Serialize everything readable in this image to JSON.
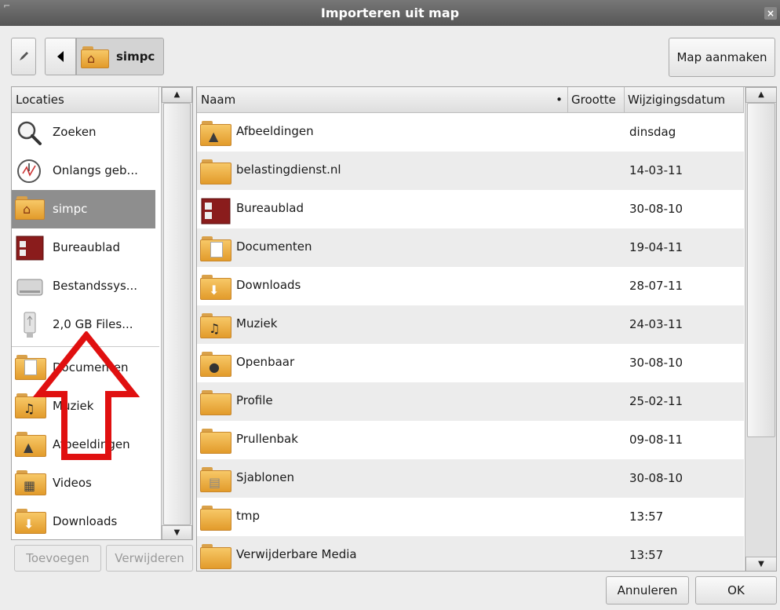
{
  "window": {
    "title": "Importeren uit map",
    "close_glyph": "×"
  },
  "toolbar": {
    "edit_icon": "pencil-icon",
    "back_icon": "triangle-left-icon",
    "path_label": "simpc",
    "create_folder_label": "Map aanmaken"
  },
  "places": {
    "header": "Locaties",
    "items": [
      {
        "label": "Zoeken",
        "icon": "search-icon"
      },
      {
        "label": "Onlangs geb...",
        "icon": "recent-clock-icon"
      },
      {
        "label": "simpc",
        "icon": "home-folder-icon",
        "selected": true
      },
      {
        "label": "Bureaublad",
        "icon": "desktop-icon"
      },
      {
        "label": "Bestandssys...",
        "icon": "harddisk-icon"
      },
      {
        "label": "2,0 GB Files...",
        "icon": "usb-drive-icon"
      },
      {
        "label": "Documenten",
        "icon": "documents-folder-icon"
      },
      {
        "label": "Muziek",
        "icon": "music-folder-icon"
      },
      {
        "label": "Afbeeldingen",
        "icon": "pictures-folder-icon"
      },
      {
        "label": "Videos",
        "icon": "videos-folder-icon"
      },
      {
        "label": "Downloads",
        "icon": "downloads-folder-icon"
      }
    ],
    "add_label": "Toevoegen",
    "remove_label": "Verwijderen"
  },
  "files": {
    "columns": {
      "name": "Naam",
      "size": "Grootte",
      "modified": "Wijzigingsdatum"
    },
    "sort_indicator": "•",
    "rows": [
      {
        "name": "Afbeeldingen",
        "date": "dinsdag",
        "icon": "pictures-folder-icon"
      },
      {
        "name": "belastingdienst.nl",
        "date": "14-03-11",
        "icon": "folder-icon"
      },
      {
        "name": "Bureaublad",
        "date": "30-08-10",
        "icon": "desktop-icon"
      },
      {
        "name": "Documenten",
        "date": "19-04-11",
        "icon": "documents-folder-icon"
      },
      {
        "name": "Downloads",
        "date": "28-07-11",
        "icon": "downloads-folder-icon"
      },
      {
        "name": "Muziek",
        "date": "24-03-11",
        "icon": "music-folder-icon"
      },
      {
        "name": "Openbaar",
        "date": "30-08-10",
        "icon": "public-folder-icon"
      },
      {
        "name": "Profile",
        "date": "25-02-11",
        "icon": "folder-icon"
      },
      {
        "name": "Prullenbak",
        "date": "09-08-11",
        "icon": "folder-icon"
      },
      {
        "name": "Sjablonen",
        "date": "30-08-10",
        "icon": "templates-folder-icon"
      },
      {
        "name": "tmp",
        "date": "13:57",
        "icon": "folder-icon"
      },
      {
        "name": "Verwijderbare Media",
        "date": "13:57",
        "icon": "folder-icon"
      }
    ]
  },
  "footer": {
    "cancel_label": "Annuleren",
    "ok_label": "OK"
  },
  "colors": {
    "selection": "#8e8e8e",
    "folder": "#f0b048",
    "annotation_arrow": "#e01010"
  }
}
